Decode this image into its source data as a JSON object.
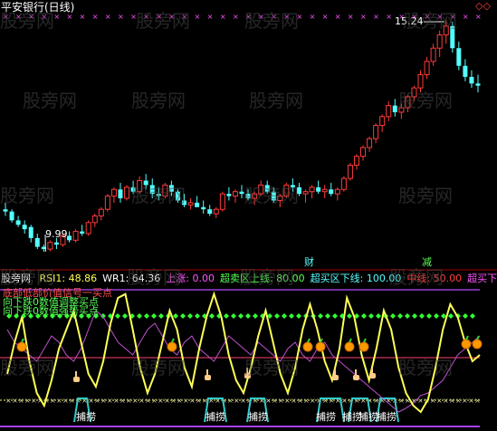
{
  "upper": {
    "title": "平安银行(日线)",
    "high_label": "15.24",
    "low_label": "9.99",
    "marker_cai": "财",
    "marker_jian": "减",
    "watermark": "股旁网",
    "corner_icon": "diamond-outline-icon"
  },
  "lower": {
    "panel_name": "股旁网",
    "indicators": [
      {
        "label": "RSI1:",
        "value": "48.86",
        "color": "#ffff55"
      },
      {
        "label": "WR1:",
        "value": "64.36",
        "color": "#ffffff"
      },
      {
        "label": "上涨:",
        "value": "0.00",
        "color": "#ff55ff"
      },
      {
        "label": "超卖区上线:",
        "value": "80.00",
        "color": "#55ff55"
      },
      {
        "label": "超买区下线:",
        "value": "100.00",
        "color": "#55ffff"
      },
      {
        "label": "中线:",
        "value": "50.00",
        "color": "#ff4040"
      },
      {
        "label": "超买下",
        "value": "",
        "color": "#ff55ff"
      }
    ],
    "overlay_texts": [
      "底部低部价值信号一买点",
      "向下跌0数值调整买点",
      "向下跌0数值强势买点"
    ],
    "bottom_label": "捕捞",
    "signal_icons": [
      "apple-icon",
      "hand-pointer-icon"
    ]
  },
  "chart_data": [
    {
      "type": "candlestick",
      "title": "平安银行(日线)",
      "annotations": [
        "15.24",
        "9.99",
        "财",
        "减"
      ],
      "high": 15.24,
      "low": 9.99,
      "ohlc": [
        [
          10.95,
          11.1,
          10.8,
          10.9
        ],
        [
          10.9,
          10.95,
          10.65,
          10.7
        ],
        [
          10.7,
          10.8,
          10.55,
          10.6
        ],
        [
          10.6,
          10.7,
          10.4,
          10.5
        ],
        [
          10.55,
          10.6,
          10.2,
          10.3
        ],
        [
          10.3,
          10.4,
          10.05,
          10.1
        ],
        [
          10.1,
          10.15,
          9.99,
          10.05
        ],
        [
          10.05,
          10.25,
          10.0,
          10.2
        ],
        [
          10.2,
          10.3,
          10.05,
          10.15
        ],
        [
          10.15,
          10.4,
          10.1,
          10.35
        ],
        [
          10.35,
          10.45,
          10.2,
          10.25
        ],
        [
          10.25,
          10.5,
          10.2,
          10.45
        ],
        [
          10.45,
          10.6,
          10.35,
          10.4
        ],
        [
          10.4,
          10.7,
          10.35,
          10.65
        ],
        [
          10.65,
          10.85,
          10.55,
          10.8
        ],
        [
          10.8,
          11.0,
          10.7,
          10.95
        ],
        [
          10.95,
          11.3,
          10.9,
          11.25
        ],
        [
          11.25,
          11.45,
          11.1,
          11.4
        ],
        [
          11.4,
          11.55,
          11.1,
          11.2
        ],
        [
          11.2,
          11.5,
          11.15,
          11.45
        ],
        [
          11.45,
          11.6,
          11.3,
          11.35
        ],
        [
          11.35,
          11.7,
          11.3,
          11.6
        ],
        [
          11.6,
          11.75,
          11.4,
          11.5
        ],
        [
          11.5,
          11.65,
          11.2,
          11.3
        ],
        [
          11.3,
          11.45,
          11.15,
          11.25
        ],
        [
          11.25,
          11.55,
          11.2,
          11.5
        ],
        [
          11.5,
          11.6,
          11.25,
          11.35
        ],
        [
          11.35,
          11.4,
          11.1,
          11.15
        ],
        [
          11.15,
          11.3,
          11.0,
          11.05
        ],
        [
          11.05,
          11.2,
          10.95,
          11.1
        ],
        [
          11.1,
          11.25,
          11.0,
          11.0
        ],
        [
          11.0,
          11.15,
          10.85,
          10.95
        ],
        [
          10.95,
          11.05,
          10.8,
          10.85
        ],
        [
          10.85,
          11.0,
          10.75,
          10.95
        ],
        [
          10.95,
          11.35,
          10.9,
          11.3
        ],
        [
          11.3,
          11.45,
          11.15,
          11.25
        ],
        [
          11.25,
          11.4,
          11.1,
          11.35
        ],
        [
          11.35,
          11.5,
          11.2,
          11.3
        ],
        [
          11.3,
          11.4,
          11.15,
          11.2
        ],
        [
          11.2,
          11.35,
          11.05,
          11.3
        ],
        [
          11.3,
          11.6,
          11.25,
          11.5
        ],
        [
          11.5,
          11.6,
          11.3,
          11.35
        ],
        [
          11.35,
          11.45,
          11.1,
          11.15
        ],
        [
          11.15,
          11.3,
          11.0,
          11.25
        ],
        [
          11.25,
          11.55,
          11.2,
          11.5
        ],
        [
          11.5,
          11.65,
          11.35,
          11.45
        ],
        [
          11.45,
          11.55,
          11.25,
          11.3
        ],
        [
          11.3,
          11.4,
          11.1,
          11.35
        ],
        [
          11.35,
          11.5,
          11.2,
          11.45
        ],
        [
          11.45,
          11.6,
          11.3,
          11.35
        ],
        [
          11.35,
          11.5,
          11.2,
          11.4
        ],
        [
          11.4,
          11.55,
          11.25,
          11.3
        ],
        [
          11.3,
          11.45,
          11.15,
          11.4
        ],
        [
          11.4,
          11.7,
          11.35,
          11.65
        ],
        [
          11.65,
          12.0,
          11.6,
          11.95
        ],
        [
          11.95,
          12.2,
          11.85,
          12.15
        ],
        [
          12.15,
          12.4,
          12.05,
          12.35
        ],
        [
          12.35,
          12.6,
          12.25,
          12.55
        ],
        [
          12.55,
          12.9,
          12.45,
          12.85
        ],
        [
          12.85,
          13.1,
          12.7,
          13.05
        ],
        [
          13.05,
          13.4,
          12.95,
          13.3
        ],
        [
          13.3,
          13.45,
          13.05,
          13.15
        ],
        [
          13.15,
          13.35,
          13.0,
          13.25
        ],
        [
          13.25,
          13.55,
          13.15,
          13.5
        ],
        [
          13.5,
          13.75,
          13.4,
          13.7
        ],
        [
          13.7,
          14.1,
          13.6,
          14.0
        ],
        [
          14.0,
          14.4,
          13.9,
          14.3
        ],
        [
          14.3,
          14.7,
          14.2,
          14.6
        ],
        [
          14.6,
          15.0,
          14.4,
          14.9
        ],
        [
          14.9,
          15.24,
          14.7,
          15.1
        ],
        [
          15.1,
          15.2,
          14.5,
          14.6
        ],
        [
          14.6,
          14.75,
          14.1,
          14.2
        ],
        [
          14.2,
          14.35,
          13.85,
          13.95
        ],
        [
          13.95,
          14.1,
          13.7,
          13.8
        ],
        [
          13.8,
          14.0,
          13.6,
          13.75
        ]
      ]
    },
    {
      "type": "line",
      "series": [
        {
          "name": "RSI1",
          "values": [
            35,
            60,
            80,
            45,
            20,
            10,
            30,
            55,
            70,
            85,
            60,
            35,
            25,
            45,
            75,
            95,
            98,
            70,
            40,
            20,
            35,
            60,
            85,
            70,
            40,
            25,
            55,
            80,
            98,
            80,
            50,
            30,
            20,
            40,
            65,
            85,
            60,
            35,
            20,
            40,
            70,
            90,
            70,
            45,
            30,
            55,
            95,
            80,
            50,
            30,
            55,
            85,
            70,
            40,
            20,
            10,
            5,
            15,
            40,
            70,
            90,
            80,
            60,
            45,
            50
          ]
        },
        {
          "name": "WR1",
          "values": [
            70,
            60,
            55,
            50,
            45,
            55,
            65,
            60,
            50,
            45,
            55,
            70,
            85,
            80,
            70,
            60,
            55,
            50,
            60,
            70,
            75,
            65,
            55,
            50,
            60,
            65,
            55,
            50,
            45,
            55,
            65,
            60,
            55,
            50,
            60,
            55,
            50,
            45,
            55,
            60,
            50,
            45,
            55,
            60,
            50,
            45,
            40,
            35,
            30,
            25,
            20,
            15,
            10,
            5,
            8,
            12,
            18,
            20,
            25,
            30,
            40,
            50,
            55,
            60,
            65
          ]
        }
      ],
      "reference_lines": {
        "超卖区上线": 80,
        "超买区下线": 100,
        "中线": 50
      }
    }
  ]
}
